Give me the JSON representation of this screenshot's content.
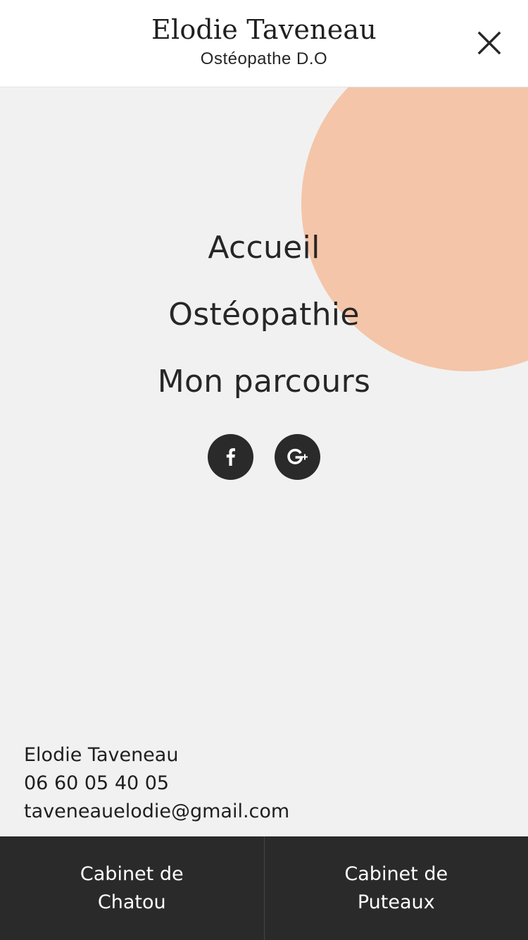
{
  "header": {
    "title": "Elodie Taveneau",
    "subtitle": "Ostéopathe D.O",
    "close_icon": "close-icon"
  },
  "nav": {
    "items": [
      {
        "label": "Accueil"
      },
      {
        "label": "Ostéopathie"
      },
      {
        "label": "Mon parcours"
      }
    ]
  },
  "social": {
    "facebook_icon": "facebook-icon",
    "google_plus_icon": "google-plus-icon"
  },
  "contact": {
    "name": "Elodie Taveneau",
    "phone": "06 60 05 40 05",
    "email": "taveneauelodie@gmail.com"
  },
  "footer": {
    "buttons": [
      {
        "line1": "Cabinet de",
        "line2": "Chatou"
      },
      {
        "line1": "Cabinet de",
        "line2": "Puteaux"
      }
    ]
  },
  "colors": {
    "accent_circle": "#f4c5a8",
    "dark": "#2a2a2a",
    "background": "#f1f1f1",
    "header_bg": "#ffffff"
  }
}
